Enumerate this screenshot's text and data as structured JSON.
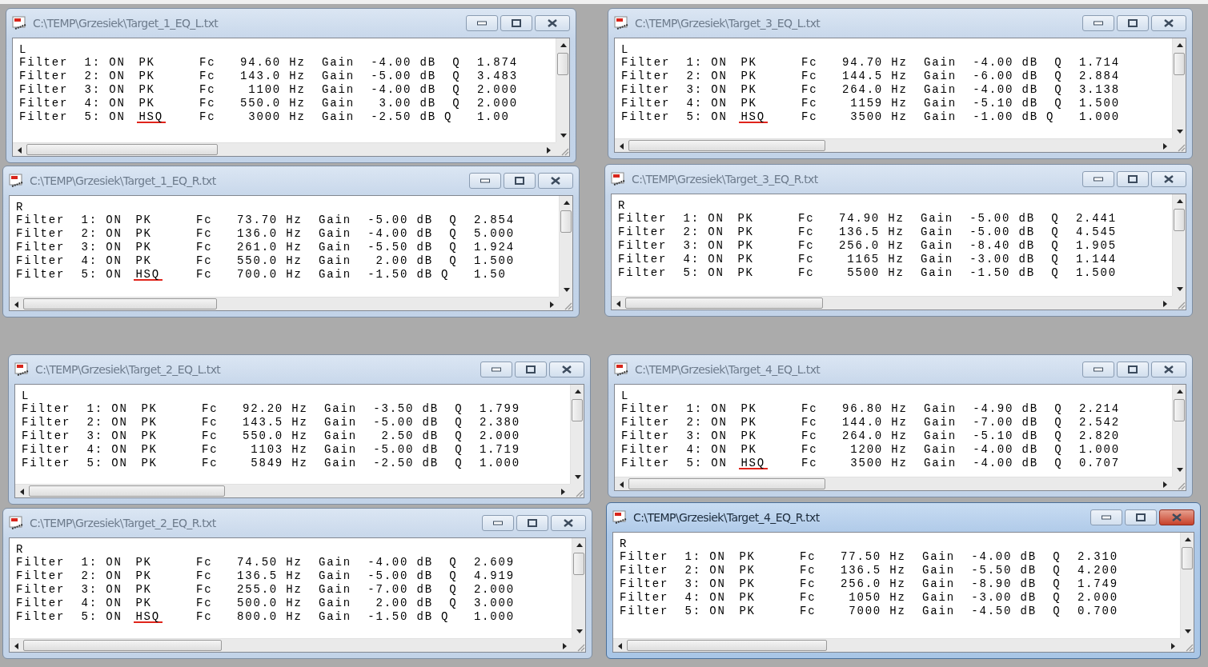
{
  "windows": [
    {
      "title": "C:\\TEMP\\Grzesiek\\Target_1_EQ_L.txt",
      "active": false,
      "channel": "L",
      "lines": [
        {
          "prefix": "Filter  1: ON",
          "type": "PK",
          "marked": false,
          "rest": "Fc   94.60 Hz  Gain  -4.00 dB  Q  1.874"
        },
        {
          "prefix": "Filter  2: ON",
          "type": "PK",
          "marked": false,
          "rest": "Fc   143.0 Hz  Gain  -5.00 dB  Q  3.483"
        },
        {
          "prefix": "Filter  3: ON",
          "type": "PK",
          "marked": false,
          "rest": "Fc    1100 Hz  Gain  -4.00 dB  Q  2.000"
        },
        {
          "prefix": "Filter  4: ON",
          "type": "PK",
          "marked": false,
          "rest": "Fc   550.0 Hz  Gain   3.00 dB  Q  2.000"
        },
        {
          "prefix": "Filter  5: ON",
          "type": "HSQ",
          "marked": true,
          "rest": "Fc    3000 Hz  Gain  -2.50 dB Q   1.00"
        }
      ]
    },
    {
      "title": "C:\\TEMP\\Grzesiek\\Target_3_EQ_L.txt",
      "active": false,
      "channel": "L",
      "lines": [
        {
          "prefix": "Filter  1: ON",
          "type": "PK",
          "marked": false,
          "rest": "Fc   94.70 Hz  Gain  -4.00 dB  Q  1.714"
        },
        {
          "prefix": "Filter  2: ON",
          "type": "PK",
          "marked": false,
          "rest": "Fc   144.5 Hz  Gain  -6.00 dB  Q  2.884"
        },
        {
          "prefix": "Filter  3: ON",
          "type": "PK",
          "marked": false,
          "rest": "Fc   264.0 Hz  Gain  -4.00 dB  Q  3.138"
        },
        {
          "prefix": "Filter  4: ON",
          "type": "PK",
          "marked": false,
          "rest": "Fc    1159 Hz  Gain  -5.10 dB  Q  1.500"
        },
        {
          "prefix": "Filter  5: ON",
          "type": "HSQ",
          "marked": true,
          "rest": "Fc    3500 Hz  Gain  -1.00 dB Q   1.000"
        }
      ]
    },
    {
      "title": "C:\\TEMP\\Grzesiek\\Target_1_EQ_R.txt",
      "active": false,
      "channel": "R",
      "lines": [
        {
          "prefix": "Filter  1: ON",
          "type": "PK",
          "marked": false,
          "rest": "Fc   73.70 Hz  Gain  -5.00 dB  Q  2.854"
        },
        {
          "prefix": "Filter  2: ON",
          "type": "PK",
          "marked": false,
          "rest": "Fc   136.0 Hz  Gain  -4.00 dB  Q  5.000"
        },
        {
          "prefix": "Filter  3: ON",
          "type": "PK",
          "marked": false,
          "rest": "Fc   261.0 Hz  Gain  -5.50 dB  Q  1.924"
        },
        {
          "prefix": "Filter  4: ON",
          "type": "PK",
          "marked": false,
          "rest": "Fc   550.0 Hz  Gain   2.00 dB  Q  1.500"
        },
        {
          "prefix": "Filter  5: ON",
          "type": "HSQ",
          "marked": true,
          "rest": "Fc   700.0 Hz  Gain  -1.50 dB Q   1.50"
        }
      ]
    },
    {
      "title": "C:\\TEMP\\Grzesiek\\Target_3_EQ_R.txt",
      "active": false,
      "channel": "R",
      "lines": [
        {
          "prefix": "Filter  1: ON",
          "type": "PK",
          "marked": false,
          "rest": "Fc   74.90 Hz  Gain  -5.00 dB  Q  2.441"
        },
        {
          "prefix": "Filter  2: ON",
          "type": "PK",
          "marked": false,
          "rest": "Fc   136.5 Hz  Gain  -5.00 dB  Q  4.545"
        },
        {
          "prefix": "Filter  3: ON",
          "type": "PK",
          "marked": false,
          "rest": "Fc   256.0 Hz  Gain  -8.40 dB  Q  1.905"
        },
        {
          "prefix": "Filter  4: ON",
          "type": "PK",
          "marked": false,
          "rest": "Fc    1165 Hz  Gain  -3.00 dB  Q  1.144"
        },
        {
          "prefix": "Filter  5: ON",
          "type": "PK",
          "marked": false,
          "rest": "Fc    5500 Hz  Gain  -1.50 dB  Q  1.500"
        }
      ]
    },
    {
      "title": "C:\\TEMP\\Grzesiek\\Target_2_EQ_L.txt",
      "active": false,
      "channel": "L",
      "lines": [
        {
          "prefix": "Filter  1: ON",
          "type": "PK",
          "marked": false,
          "rest": "Fc   92.20 Hz  Gain  -3.50 dB  Q  1.799"
        },
        {
          "prefix": "Filter  2: ON",
          "type": "PK",
          "marked": false,
          "rest": "Fc   143.5 Hz  Gain  -5.00 dB  Q  2.380"
        },
        {
          "prefix": "Filter  3: ON",
          "type": "PK",
          "marked": false,
          "rest": "Fc   550.0 Hz  Gain   2.50 dB  Q  2.000"
        },
        {
          "prefix": "Filter  4: ON",
          "type": "PK",
          "marked": false,
          "rest": "Fc    1103 Hz  Gain  -5.00 dB  Q  1.719"
        },
        {
          "prefix": "Filter  5: ON",
          "type": "PK",
          "marked": false,
          "rest": "Fc    5849 Hz  Gain  -2.50 dB  Q  1.000"
        }
      ]
    },
    {
      "title": "C:\\TEMP\\Grzesiek\\Target_4_EQ_L.txt",
      "active": false,
      "channel": "L",
      "lines": [
        {
          "prefix": "Filter  1: ON",
          "type": "PK",
          "marked": false,
          "rest": "Fc   96.80 Hz  Gain  -4.90 dB  Q  2.214"
        },
        {
          "prefix": "Filter  2: ON",
          "type": "PK",
          "marked": false,
          "rest": "Fc   144.0 Hz  Gain  -7.00 dB  Q  2.542"
        },
        {
          "prefix": "Filter  3: ON",
          "type": "PK",
          "marked": false,
          "rest": "Fc   264.0 Hz  Gain  -5.10 dB  Q  2.820"
        },
        {
          "prefix": "Filter  4: ON",
          "type": "PK",
          "marked": false,
          "rest": "Fc    1200 Hz  Gain  -4.00 dB  Q  1.000"
        },
        {
          "prefix": "Filter  5: ON",
          "type": "HSQ",
          "marked": true,
          "rest": "Fc    3500 Hz  Gain  -4.00 dB  Q  0.707"
        }
      ]
    },
    {
      "title": "C:\\TEMP\\Grzesiek\\Target_2_EQ_R.txt",
      "active": false,
      "channel": "R",
      "lines": [
        {
          "prefix": "Filter  1: ON",
          "type": "PK",
          "marked": false,
          "rest": "Fc   74.50 Hz  Gain  -4.00 dB  Q  2.609"
        },
        {
          "prefix": "Filter  2: ON",
          "type": "PK",
          "marked": false,
          "rest": "Fc   136.5 Hz  Gain  -5.00 dB  Q  4.919"
        },
        {
          "prefix": "Filter  3: ON",
          "type": "PK",
          "marked": false,
          "rest": "Fc   255.0 Hz  Gain  -7.00 dB  Q  2.000"
        },
        {
          "prefix": "Filter  4: ON",
          "type": "PK",
          "marked": false,
          "rest": "Fc   500.0 Hz  Gain   2.00 dB  Q  3.000"
        },
        {
          "prefix": "Filter  5: ON",
          "type": "HSQ",
          "marked": true,
          "rest": "Fc   800.0 Hz  Gain  -1.50 dB Q   1.000"
        }
      ]
    },
    {
      "title": "C:\\TEMP\\Grzesiek\\Target_4_EQ_R.txt",
      "active": true,
      "channel": "R",
      "lines": [
        {
          "prefix": "Filter  1: ON",
          "type": "PK",
          "marked": false,
          "rest": "Fc   77.50 Hz  Gain  -4.00 dB  Q  2.310"
        },
        {
          "prefix": "Filter  2: ON",
          "type": "PK",
          "marked": false,
          "rest": "Fc   136.5 Hz  Gain  -5.50 dB  Q  4.200"
        },
        {
          "prefix": "Filter  3: ON",
          "type": "PK",
          "marked": false,
          "rest": "Fc   256.0 Hz  Gain  -8.90 dB  Q  1.749"
        },
        {
          "prefix": "Filter  4: ON",
          "type": "PK",
          "marked": false,
          "rest": "Fc    1050 Hz  Gain  -3.00 dB  Q  2.000"
        },
        {
          "prefix": "Filter  5: ON",
          "type": "PK",
          "marked": false,
          "rest": "Fc    7000 Hz  Gain  -4.50 dB  Q  0.700"
        }
      ]
    }
  ]
}
